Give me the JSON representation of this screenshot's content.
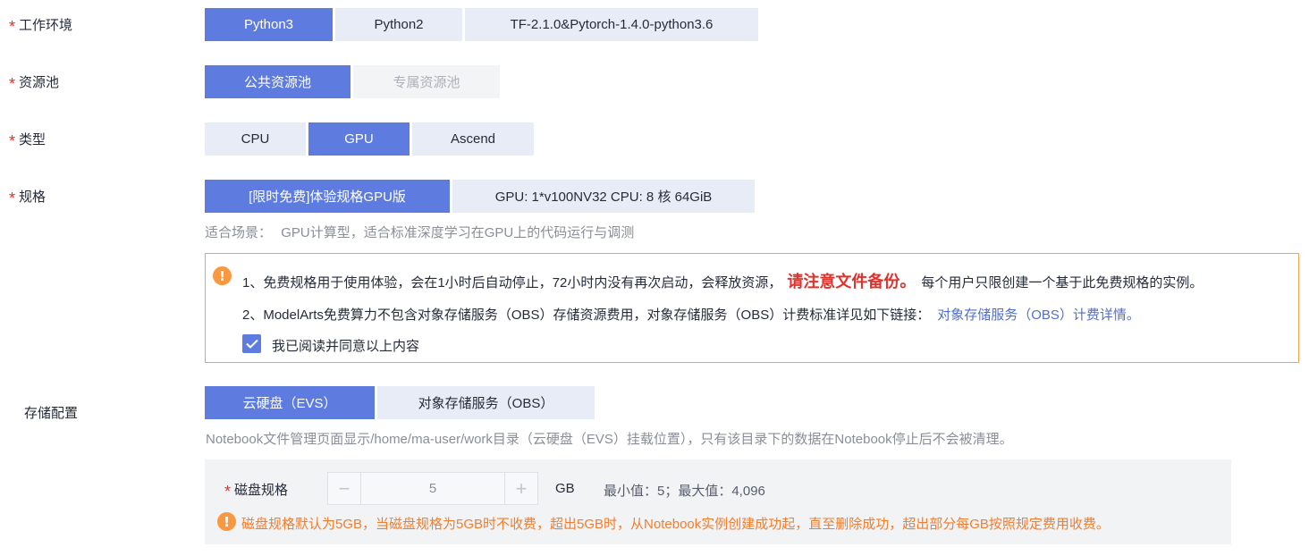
{
  "work_env": {
    "label": "工作环境",
    "options": [
      "Python3",
      "Python2",
      "TF-2.1.0&Pytorch-1.4.0-python3.6"
    ],
    "selected": "Python3"
  },
  "resource_pool": {
    "label": "资源池",
    "options": [
      "公共资源池",
      "专属资源池"
    ],
    "selected": "公共资源池"
  },
  "type": {
    "label": "类型",
    "options": [
      "CPU",
      "GPU",
      "Ascend"
    ],
    "selected": "GPU"
  },
  "spec": {
    "label": "规格",
    "selected_label": "[限时免费]体验规格GPU版",
    "detail": "GPU: 1*v100NV32 CPU: 8 核 64GiB",
    "scenario_prefix": "适合场景：",
    "scenario": "GPU计算型，适合标准深度学习在GPU上的代码运行与调测"
  },
  "notice": {
    "line1_a": "1、免费规格用于使用体验，会在1小时后自动停止，72小时内没有再次启动，会释放资源，",
    "line1_emph": "请注意文件备份。",
    "line1_b": "每个用户只限创建一个基于此免费规格的实例。",
    "line2_a": "2、ModelArts免费算力不包含对象存储服务（OBS）存储资源费用，对象存储服务（OBS）计费标准详见如下链接：",
    "line2_link": "对象存储服务（OBS）计费详情。",
    "agree_label": "我已阅读并同意以上内容",
    "agree_checked": true
  },
  "storage": {
    "label": "存储配置",
    "options": [
      "云硬盘（EVS）",
      "对象存储服务（OBS）"
    ],
    "selected": "云硬盘（EVS）",
    "hint": "Notebook文件管理页面显示/home/ma-user/work目录（云硬盘（EVS）挂载位置），只有该目录下的数据在Notebook停止后不会被清理。",
    "disk_label": "磁盘规格",
    "disk_value": "5",
    "disk_unit": "GB",
    "disk_range": "最小值：5；最大值：4,096",
    "disk_warning": "磁盘规格默认为5GB，当磁盘规格为5GB时不收费，超出5GB时，从Notebook实例创建成功起，直至删除成功，超出部分每GB按照规定费用收费。"
  },
  "colors": {
    "accent": "#5e7ce0",
    "segment_bg": "#e8ecf6",
    "required": "#e0322c",
    "warning": "#fa9841",
    "warning_text": "#f27d2e",
    "link": "#526ecc"
  }
}
